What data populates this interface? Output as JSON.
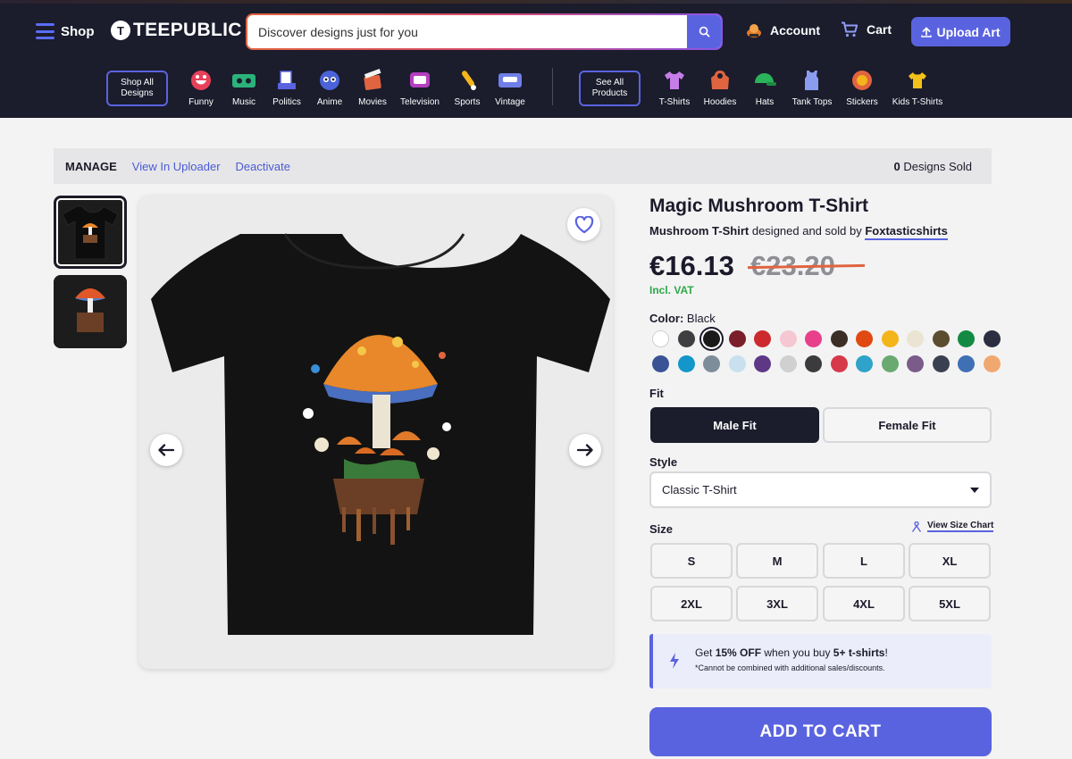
{
  "header": {
    "shop_label": "Shop",
    "logo_text": "TEEPUBLIC",
    "search_placeholder": "Discover designs just for you",
    "account_label": "Account",
    "cart_label": "Cart",
    "upload_label": "Upload Art"
  },
  "nav": {
    "shop_all": "Shop All Designs",
    "categories": [
      "Funny",
      "Music",
      "Politics",
      "Anime",
      "Movies",
      "Television",
      "Sports",
      "Vintage"
    ],
    "see_all": "See All Products",
    "products": [
      "T-Shirts",
      "Hoodies",
      "Hats",
      "Tank Tops",
      "Stickers",
      "Kids T-Shirts"
    ]
  },
  "manage": {
    "title": "MANAGE",
    "view_uploader": "View In Uploader",
    "deactivate": "Deactivate",
    "sold_count": "0",
    "sold_label": "Designs Sold"
  },
  "product": {
    "title": "Magic Mushroom T-Shirt",
    "design_name": "Mushroom T-Shirt",
    "designed_by_text": "designed and sold by",
    "seller": "Foxtasticshirts",
    "price": "€16.13",
    "old_price": "€23.20",
    "vat_label": "Incl. VAT",
    "color_label": "Color:",
    "color_value": "Black",
    "colors": [
      "#ffffff",
      "#3f3f42",
      "#1a1a1a",
      "#7a1f2a",
      "#cc2a2e",
      "#f4c7d2",
      "#e8408a",
      "#3b2e27",
      "#e04a12",
      "#f3b51a",
      "#ece4d2",
      "#5b4d2e",
      "#138a44",
      "#2a2e40",
      "#3a5396",
      "#1396c9",
      "#7d8d99",
      "#c9e0ee",
      "#5e3786",
      "#d0d0d0",
      "#3b3b3d",
      "#d63a4a",
      "#2fa3c9",
      "#6aaa70",
      "#7b5b8a",
      "#3a3f52",
      "#3f6fb5",
      "#f1a870"
    ],
    "selected_color_index": 2,
    "fit_label": "Fit",
    "fit_options": [
      "Male Fit",
      "Female Fit"
    ],
    "style_label": "Style",
    "style_value": "Classic T-Shirt",
    "size_label": "Size",
    "size_chart": "View Size Chart",
    "sizes": [
      "S",
      "M",
      "L",
      "XL",
      "2XL",
      "3XL",
      "4XL",
      "5XL"
    ],
    "promo_get": "Get",
    "promo_discount": "15% OFF",
    "promo_when": "when you buy",
    "promo_qty": "5+ t-shirts",
    "promo_end": "!",
    "promo_note": "*Cannot be combined with additional sales/discounts.",
    "add_to_cart": "ADD TO CART"
  },
  "colors": {
    "brand": "#5a63df",
    "header_bg": "#1b1c2c",
    "vat_green": "#2ea84a",
    "strike": "#e0643f"
  }
}
